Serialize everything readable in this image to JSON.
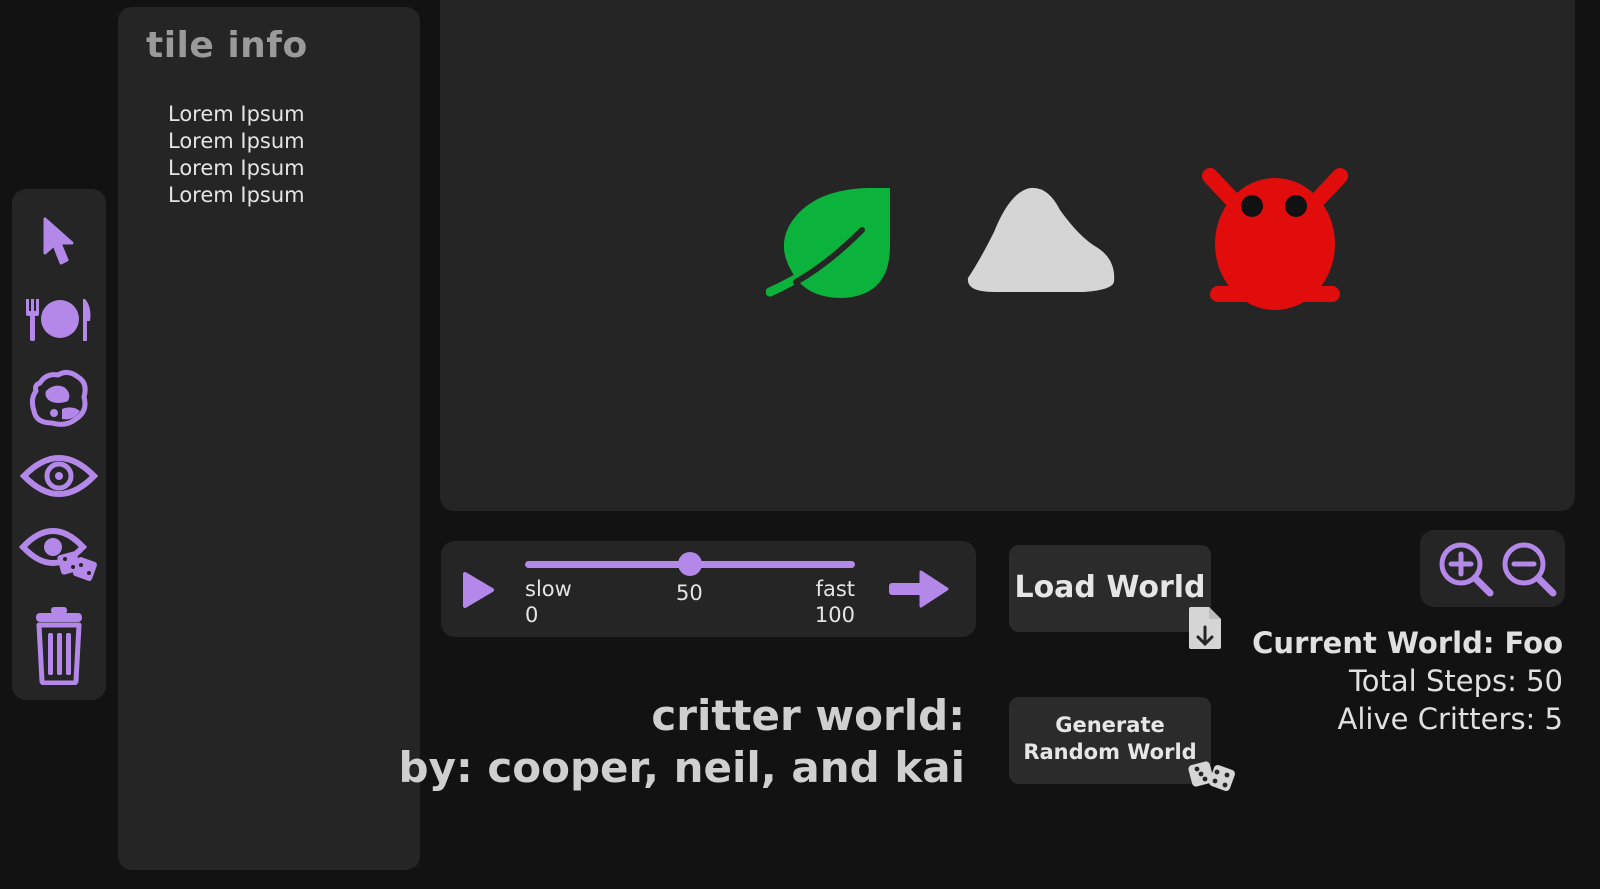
{
  "tile_info": {
    "title": "tile info",
    "lines": [
      "Lorem Ipsum",
      "Lorem Ipsum",
      "Lorem Ipsum",
      "Lorem Ipsum"
    ]
  },
  "toolbar": {
    "tools": [
      {
        "name": "select-tool",
        "icon": "pointer-icon"
      },
      {
        "name": "food-tool",
        "icon": "fork-plate-knife-icon"
      },
      {
        "name": "rock-tool",
        "icon": "rock-icon"
      },
      {
        "name": "view-tool",
        "icon": "eye-icon"
      },
      {
        "name": "random-view-tool",
        "icon": "eye-dice-icon"
      },
      {
        "name": "delete-tool",
        "icon": "trash-icon"
      }
    ]
  },
  "world_tiles": [
    {
      "name": "food-tile",
      "icon": "leaf-icon",
      "color": "#0bb33c"
    },
    {
      "name": "rock-tile",
      "icon": "rock-icon",
      "color": "#d5d5d5"
    },
    {
      "name": "critter-tile",
      "icon": "critter-icon",
      "color": "#e10d0d"
    }
  ],
  "playback": {
    "speed_value": 50,
    "speed_value_label": "50",
    "min_word": "slow",
    "min_value": "0",
    "max_word": "fast",
    "max_value": "100"
  },
  "buttons": {
    "load_world": "Load World",
    "generate_line1": "Generate",
    "generate_line2": "Random World"
  },
  "credits": {
    "line1": "critter world:",
    "line2": "by: cooper, neil, and kai"
  },
  "stats": {
    "current_world": "Current World: Foo",
    "total_steps": "Total Steps: 50",
    "alive_critters": "Alive Critters: 5"
  },
  "colors": {
    "accent": "#b388e8",
    "panel": "#252525",
    "background": "#121212"
  }
}
